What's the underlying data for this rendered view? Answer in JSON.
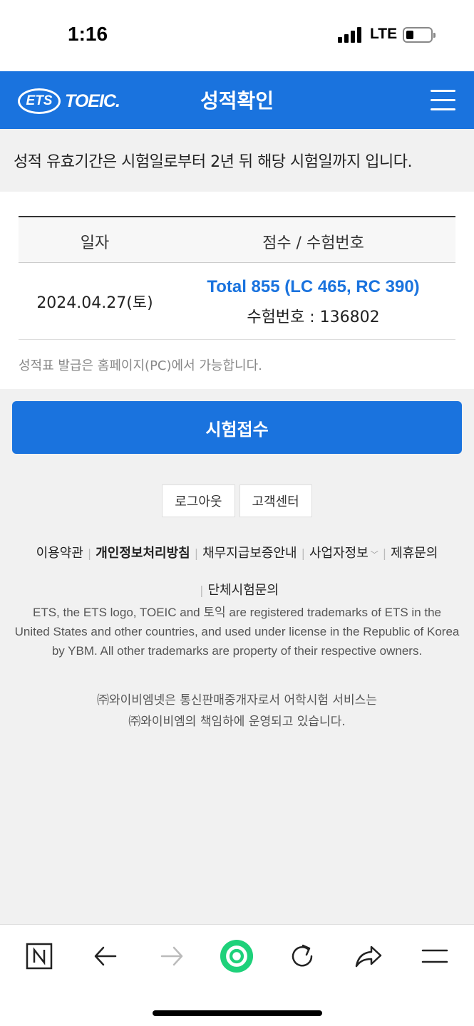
{
  "status": {
    "time": "1:16",
    "network": "LTE"
  },
  "header": {
    "logo_ets": "ETS",
    "logo_toeic": "TOEIC.",
    "title": "성적확인",
    "brand_color": "#1a73de"
  },
  "notice": {
    "text": "성적 유효기간은 시험일로부터 2년 뒤 해당 시험일까지 입니다."
  },
  "score_table": {
    "headers": {
      "date": "일자",
      "score": "점수 / 수험번호"
    },
    "rows": [
      {
        "date": "2024.04.27(토)",
        "total": "Total 855 (LC 465, RC 390)",
        "exam_number": "수험번호 : 136802"
      }
    ],
    "report_note": "성적표 발급은 홈페이지(PC)에서 가능합니다."
  },
  "apply_button": {
    "label": "시험접수"
  },
  "footer": {
    "buttons": {
      "logout": "로그아웃",
      "support": "고객센터"
    },
    "links": {
      "terms": "이용약관",
      "privacy": "개인정보처리방침",
      "guarantee": "채무지급보증안내",
      "business": "사업자정보",
      "partnership": "제휴문의",
      "group": "단체시험문의"
    },
    "legal": "ETS, the ETS logo, TOEIC and 토익 are registered trademarks of ETS in the United States and other countries, and used under license in the Republic of Korea by YBM. All other trademarks are property of their respective owners.",
    "ybm_note_1": "㈜와이비엠넷은 통신판매중개자로서 어학시험 서비스는",
    "ybm_note_2": "㈜와이비엠의 책임하에 운영되고 있습니다."
  },
  "browser_bar": {
    "icons": [
      "naver-n-icon",
      "back-arrow-icon",
      "forward-arrow-icon",
      "green-dot-icon",
      "reload-icon",
      "share-icon",
      "menu-icon"
    ]
  }
}
